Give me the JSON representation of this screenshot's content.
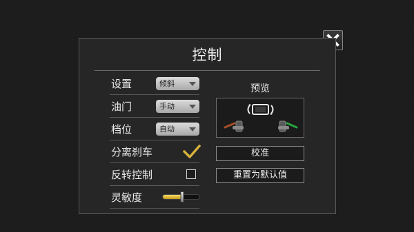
{
  "dialog": {
    "title": "控制",
    "close_icon": "close-icon"
  },
  "settings": [
    {
      "label": "设置",
      "type": "dropdown",
      "value": "倾斜"
    },
    {
      "label": "油门",
      "type": "dropdown",
      "value": "手动"
    },
    {
      "label": "档位",
      "type": "dropdown",
      "value": "自动"
    },
    {
      "label": "分离刹车",
      "type": "checkbox",
      "checked": true
    },
    {
      "label": "反转控制",
      "type": "checkbox",
      "checked": false
    },
    {
      "label": "灵敏度",
      "type": "slider",
      "value": 0.52
    }
  ],
  "preview": {
    "label": "预览",
    "icons": [
      "tilt-device-icon",
      "left-brake-lever-icon",
      "right-throttle-lever-icon"
    ],
    "left_lever_color": "#d2612a",
    "right_lever_color": "#2bd24a"
  },
  "buttons": {
    "calibrate": "校准",
    "reset_default": "重置为默认值"
  },
  "colors": {
    "check_accent": "#d6b23a",
    "slider_fill": "#e3bb3c"
  }
}
